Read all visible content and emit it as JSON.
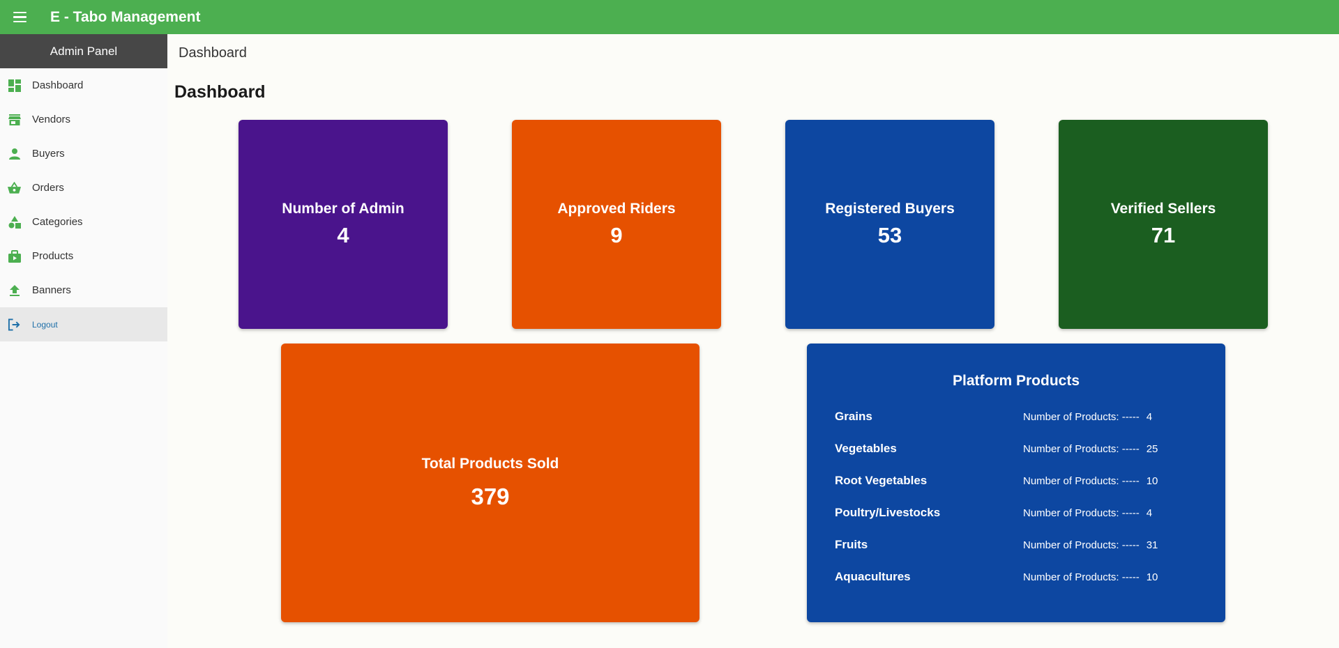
{
  "app": {
    "title": "E - Tabo Management"
  },
  "sidebar": {
    "header": "Admin Panel",
    "items": [
      {
        "label": "Dashboard",
        "icon": "dashboard-icon"
      },
      {
        "label": "Vendors",
        "icon": "store-icon"
      },
      {
        "label": "Buyers",
        "icon": "person-icon"
      },
      {
        "label": "Orders",
        "icon": "basket-icon"
      },
      {
        "label": "Categories",
        "icon": "category-icon"
      },
      {
        "label": "Products",
        "icon": "shopping-bag-icon"
      },
      {
        "label": "Banners",
        "icon": "upload-icon"
      }
    ],
    "logout": {
      "label": "Logout",
      "icon": "logout-icon"
    }
  },
  "main": {
    "breadcrumb": "Dashboard",
    "title": "Dashboard"
  },
  "cards": {
    "admin": {
      "label": "Number of Admin",
      "value": "4",
      "color": "#4a148c"
    },
    "riders": {
      "label": "Approved Riders",
      "value": "9",
      "color": "#e65100"
    },
    "buyers": {
      "label": "Registered Buyers",
      "value": "53",
      "color": "#0d47a1"
    },
    "sellers": {
      "label": "Verified Sellers",
      "value": "71",
      "color": "#1b5e20"
    },
    "sold": {
      "label": "Total Products Sold",
      "value": "379",
      "color": "#e65100"
    }
  },
  "platform": {
    "title": "Platform Products",
    "count_label": "Number of Products: -----",
    "categories": [
      {
        "name": "Grains",
        "count": "4"
      },
      {
        "name": "Vegetables",
        "count": "25"
      },
      {
        "name": "Root Vegetables",
        "count": "10"
      },
      {
        "name": "Poultry/Livestocks",
        "count": "4"
      },
      {
        "name": "Fruits",
        "count": "31"
      },
      {
        "name": "Aquacultures",
        "count": "10"
      }
    ]
  },
  "colors": {
    "topbar": "#4caf50",
    "sidebar_header": "#474747",
    "icon_green": "#4caf50"
  }
}
